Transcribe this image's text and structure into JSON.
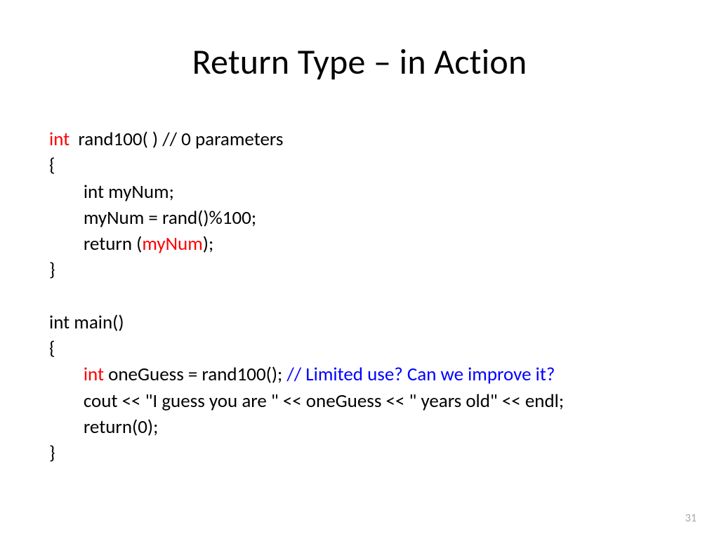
{
  "slide": {
    "title": "Return Type – in Action",
    "page_number": "31"
  },
  "code": {
    "l1a": "int",
    "l1b": "  rand100( ) // 0 parameters",
    "l2": "{",
    "l3": "int myNum;",
    "l4": "myNum = rand()%100;",
    "l5a": "return (",
    "l5b": "myNum",
    "l5c": ");",
    "l6": "}",
    "l8": "int main()",
    "l9": "{",
    "l10a": "int",
    "l10b": " oneGuess = rand100(); ",
    "l10c": "// Limited use? Can we improve it?",
    "l11": "cout << \"I guess you are \" << oneGuess << \" years old\" << endl;",
    "l12": "return(0);",
    "l13": "}"
  }
}
